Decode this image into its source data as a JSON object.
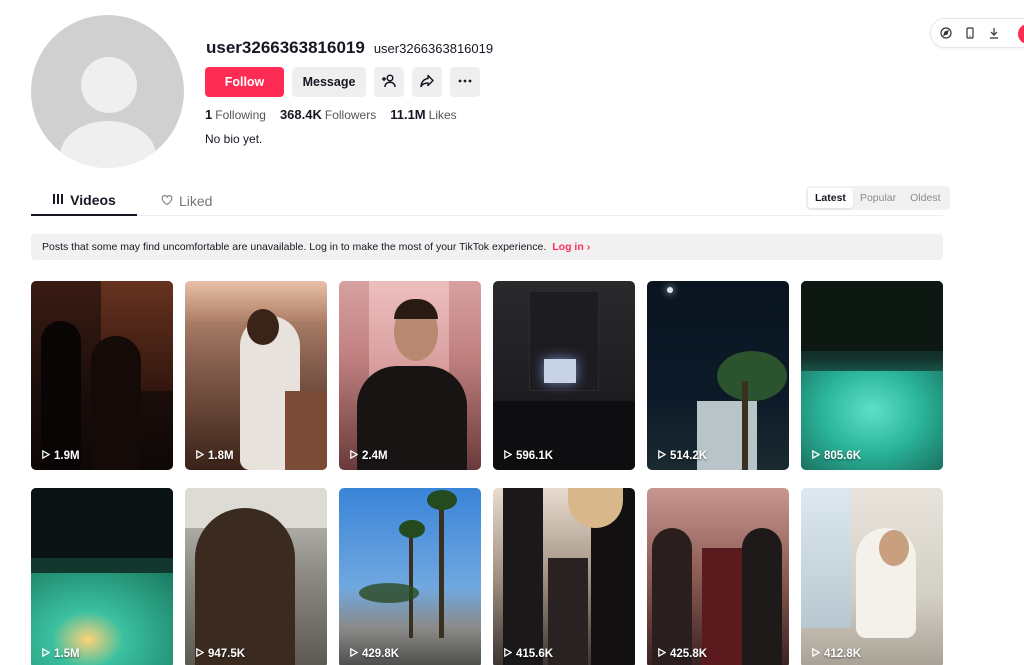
{
  "profile": {
    "username": "user3266363816019",
    "nickname": "user3266363816019",
    "follow_label": "Follow",
    "message_label": "Message",
    "stats": [
      {
        "value": "1",
        "label": "Following"
      },
      {
        "value": "368.4K",
        "label": "Followers"
      },
      {
        "value": "11.1M",
        "label": "Likes"
      }
    ],
    "bio": "No bio yet."
  },
  "tabs": {
    "videos": "Videos",
    "liked": "Liked"
  },
  "sort": {
    "latest": "Latest",
    "popular": "Popular",
    "oldest": "Oldest",
    "selected": "Latest"
  },
  "notice": {
    "text": "Posts that some may find uncomfortable are unavailable. Log in to make the most of your TikTok experience.",
    "login": "Log in"
  },
  "videos": [
    {
      "views": "1.9M"
    },
    {
      "views": "1.8M"
    },
    {
      "views": "2.4M"
    },
    {
      "views": "596.1K"
    },
    {
      "views": "514.2K"
    },
    {
      "views": "805.6K"
    },
    {
      "views": "1.5M"
    },
    {
      "views": "947.5K"
    },
    {
      "views": "429.8K"
    },
    {
      "views": "415.6K"
    },
    {
      "views": "425.8K"
    },
    {
      "views": "412.8K"
    }
  ],
  "colors": {
    "accent": "#fe2c55",
    "text": "#161823",
    "muted_bg": "#f1f1f2"
  },
  "icons": [
    "add-friend-icon",
    "share-icon",
    "more-icon",
    "compass-icon",
    "mobile-icon",
    "download-icon",
    "grid-icon",
    "heart-icon",
    "play-icon",
    "chevron-right-icon"
  ]
}
